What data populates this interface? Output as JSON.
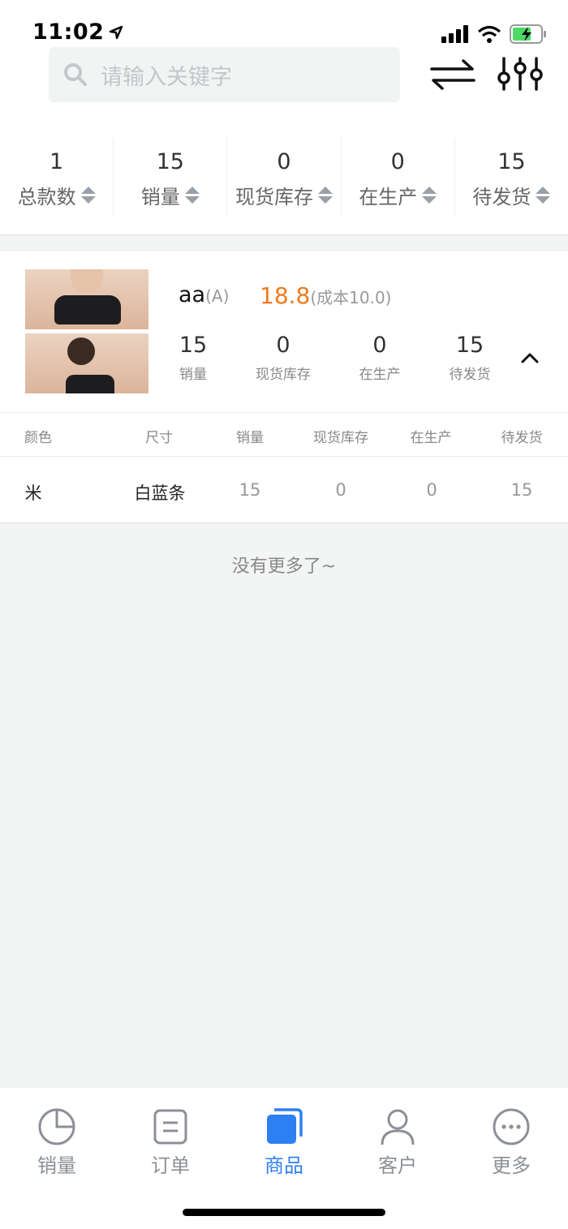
{
  "status_bar": {
    "time": "11:02"
  },
  "search": {
    "placeholder": "请输入关键字"
  },
  "summary": [
    {
      "value": "1",
      "label": "总款数"
    },
    {
      "value": "15",
      "label": "销量"
    },
    {
      "value": "0",
      "label": "现货库存"
    },
    {
      "value": "0",
      "label": "在生产"
    },
    {
      "value": "15",
      "label": "待发货"
    }
  ],
  "product": {
    "name": "aa",
    "code": "(A)",
    "price": "18.8",
    "cost": "(成本10.0)",
    "stats": [
      {
        "value": "15",
        "label": "销量"
      },
      {
        "value": "0",
        "label": "现货库存"
      },
      {
        "value": "0",
        "label": "在生产"
      },
      {
        "value": "15",
        "label": "待发货"
      }
    ]
  },
  "detail_table": {
    "headers": [
      "颜色",
      "尺寸",
      "销量",
      "现货库存",
      "在生产",
      "待发货"
    ],
    "rows": [
      [
        "米",
        "白蓝条",
        "15",
        "0",
        "0",
        "15"
      ]
    ]
  },
  "list_end_text": "没有更多了~",
  "tabbar": [
    {
      "label": "销量",
      "icon": "pie-chart-icon",
      "active": false
    },
    {
      "label": "订单",
      "icon": "order-list-icon",
      "active": false
    },
    {
      "label": "商品",
      "icon": "goods-icon",
      "active": true
    },
    {
      "label": "客户",
      "icon": "person-icon",
      "active": false
    },
    {
      "label": "更多",
      "icon": "more-dots-icon",
      "active": false
    }
  ],
  "colors": {
    "accent": "#2e7ff2",
    "price": "#f07a1c"
  }
}
